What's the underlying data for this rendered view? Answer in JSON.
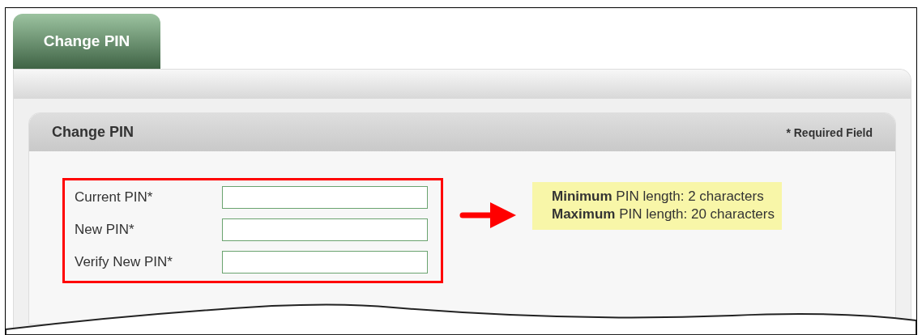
{
  "tabs": [
    {
      "label": "Change PIN",
      "selected": true
    }
  ],
  "panel": {
    "title": "Change PIN",
    "required_note": "* Required Field"
  },
  "fields": [
    {
      "label": "Current PIN*"
    },
    {
      "label": "New PIN*"
    },
    {
      "label": "Verify New PIN*"
    }
  ],
  "hint": [
    "**Minimum** PIN length: 2 characters",
    "**Maximum** PIN length: 20 characters"
  ]
}
